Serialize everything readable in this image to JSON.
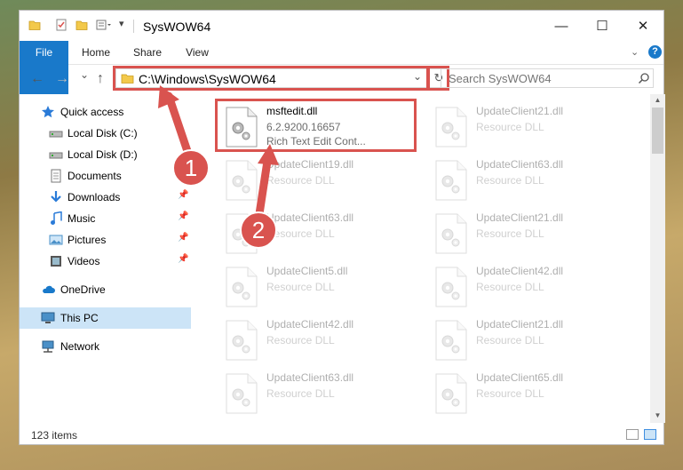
{
  "window": {
    "title": "SysWOW64",
    "controls": {
      "minimize": "—",
      "maximize": "☐",
      "close": "✕"
    }
  },
  "ribbon": {
    "tabs": [
      {
        "label": "File"
      },
      {
        "label": "Home"
      },
      {
        "label": "Share"
      },
      {
        "label": "View"
      }
    ],
    "help": "?"
  },
  "nav": {
    "back": "←",
    "forward": "→",
    "recent": "⌄",
    "up": "↑",
    "address": "C:\\Windows\\SysWOW64",
    "address_dropdown": "⌄",
    "refresh": "↻",
    "search_placeholder": "Search SysWOW64"
  },
  "sidebar": {
    "items": [
      {
        "label": "Quick access",
        "icon": "star-icon"
      },
      {
        "label": "Local Disk (C:)",
        "icon": "drive-icon",
        "pinned": true
      },
      {
        "label": "Local Disk (D:)",
        "icon": "drive-icon",
        "pinned": true
      },
      {
        "label": "Documents",
        "icon": "documents-icon",
        "pinned": true
      },
      {
        "label": "Downloads",
        "icon": "downloads-icon",
        "pinned": true
      },
      {
        "label": "Music",
        "icon": "music-icon",
        "pinned": true
      },
      {
        "label": "Pictures",
        "icon": "pictures-icon",
        "pinned": true
      },
      {
        "label": "Videos",
        "icon": "videos-icon",
        "pinned": true
      },
      {
        "label": "OneDrive",
        "icon": "cloud-icon"
      },
      {
        "label": "This PC",
        "icon": "computer-icon",
        "selected": true
      },
      {
        "label": "Network",
        "icon": "network-icon"
      }
    ]
  },
  "files": [
    {
      "name": "msftedit.dll",
      "version": "6.2.9200.16657",
      "desc": "Rich Text Edit Cont...",
      "highlighted": true
    },
    {
      "name": "UpdateClient21.dll",
      "desc": "Resource DLL"
    },
    {
      "name": "UpdateClient19.dll",
      "desc": "Resource DLL"
    },
    {
      "name": "UpdateClient63.dll",
      "desc": "Resource DLL"
    },
    {
      "name": "UpdateClient63.dll",
      "desc": "Resource DLL"
    },
    {
      "name": "UpdateClient21.dll",
      "desc": "Resource DLL"
    },
    {
      "name": "UpdateClient5.dll",
      "desc": "Resource DLL"
    },
    {
      "name": "UpdateClient42.dll",
      "desc": "Resource DLL"
    },
    {
      "name": "UpdateClient42.dll",
      "desc": "Resource DLL"
    },
    {
      "name": "UpdateClient21.dll",
      "desc": "Resource DLL"
    },
    {
      "name": "UpdateClient63.dll",
      "desc": "Resource DLL"
    },
    {
      "name": "UpdateClient65.dll",
      "desc": "Resource DLL"
    }
  ],
  "status": {
    "count": "123 items"
  },
  "callouts": {
    "one": "1",
    "two": "2"
  },
  "colors": {
    "accent": "#1979ca",
    "highlight": "#d9534f",
    "selected": "#cce4f7"
  }
}
